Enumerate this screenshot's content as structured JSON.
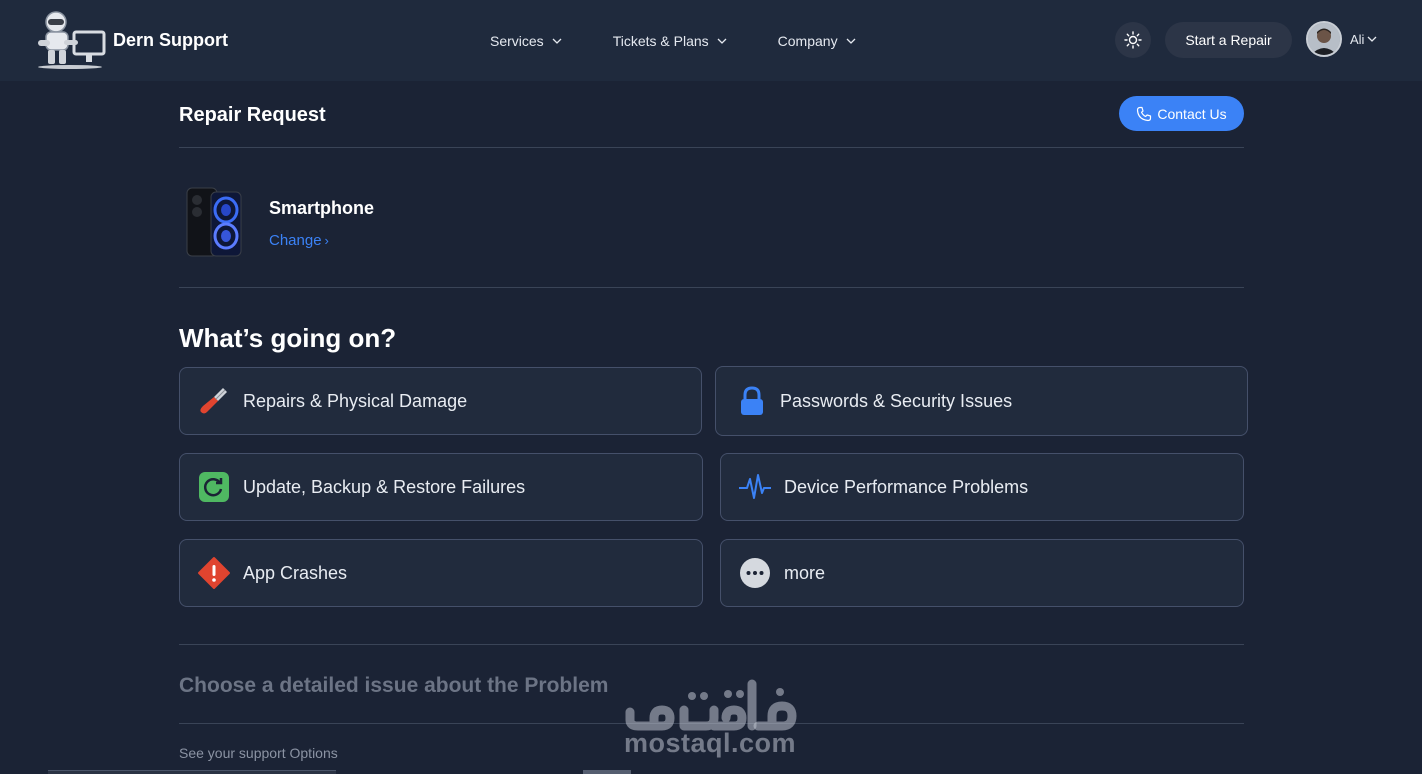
{
  "brand": {
    "name": "Dern Support"
  },
  "nav": {
    "items": [
      {
        "label": "Services"
      },
      {
        "label": "Tickets & Plans"
      },
      {
        "label": "Company"
      }
    ]
  },
  "header": {
    "theme_icon": "sun-icon",
    "start_repair_label": "Start a Repair",
    "user_name": "Ali"
  },
  "page": {
    "title": "Repair Request",
    "contact_label": "Contact Us"
  },
  "device": {
    "name": "Smartphone",
    "change_label": "Change"
  },
  "issues": {
    "title": "What’s going on?",
    "items": [
      {
        "label": "Repairs & Physical Damage",
        "icon": "screwdriver-icon",
        "color": "#e0442f"
      },
      {
        "label": "Passwords & Security Issues",
        "icon": "lock-icon",
        "color": "#3b82f6"
      },
      {
        "label": "Update, Backup & Restore Failures",
        "icon": "restore-icon",
        "color": "#4fb862"
      },
      {
        "label": "Device Performance Problems",
        "icon": "pulse-icon",
        "color": "#3b82f6"
      },
      {
        "label": "App Crashes",
        "icon": "warning-diamond-icon",
        "color": "#e0442f"
      },
      {
        "label": "more",
        "icon": "more-dots-icon",
        "color": "#d5d9df"
      }
    ]
  },
  "detail": {
    "title": "Choose a detailed issue about the Problem",
    "support_note": "See your support Options"
  },
  "watermark": {
    "text": "mostaql.com",
    "arabic": "مستقل"
  },
  "colors": {
    "background": "#1b2335",
    "header": "#1f2a3d",
    "accent": "#3b82f6",
    "card_border": "#45506a"
  }
}
